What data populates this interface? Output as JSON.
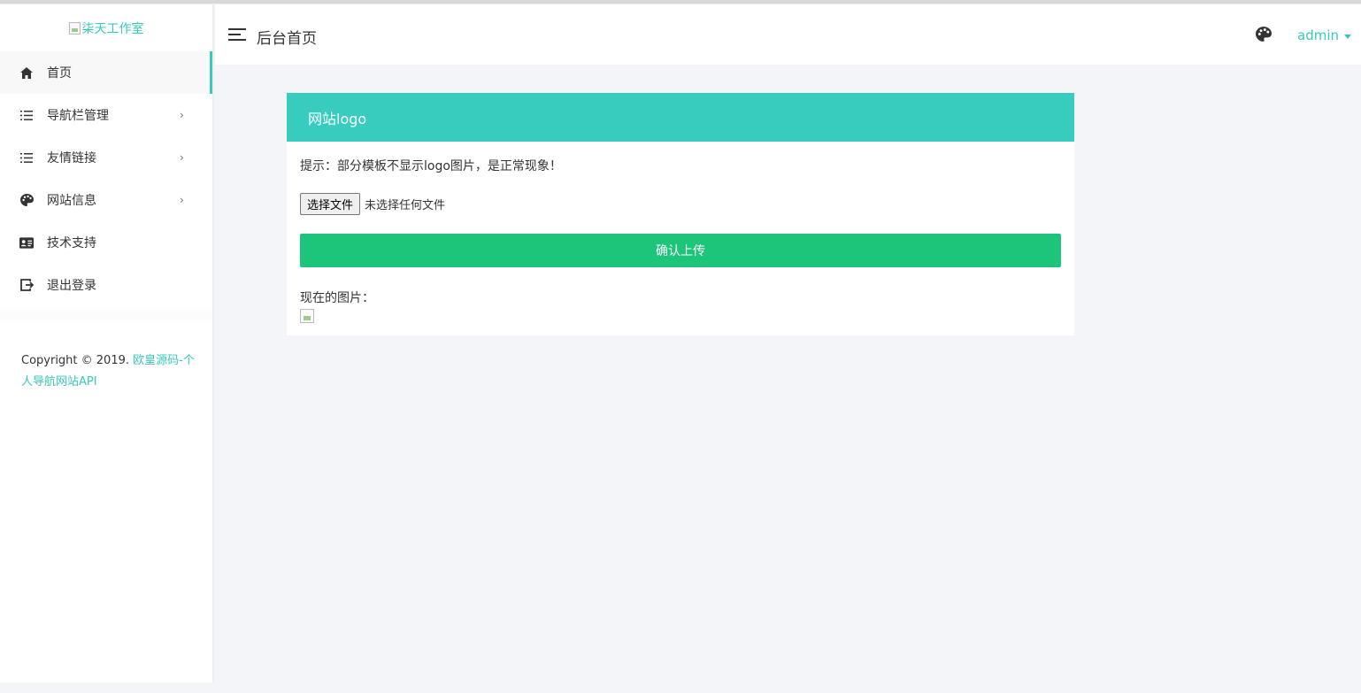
{
  "sidebar": {
    "logo_alt": "柒天工作室",
    "items": [
      {
        "label": "首页",
        "icon": "home-icon",
        "active": true,
        "has_arrow": false
      },
      {
        "label": "导航栏管理",
        "icon": "list-icon",
        "active": false,
        "has_arrow": true
      },
      {
        "label": "友情链接",
        "icon": "list-icon",
        "active": false,
        "has_arrow": true
      },
      {
        "label": "网站信息",
        "icon": "palette-icon",
        "active": false,
        "has_arrow": true
      },
      {
        "label": "技术支持",
        "icon": "id-card-icon",
        "active": false,
        "has_arrow": false
      },
      {
        "label": "退出登录",
        "icon": "logout-icon",
        "active": false,
        "has_arrow": false
      }
    ],
    "arrow": "›",
    "copyright_prefix": "Copyright © 2019.",
    "copyright_link": "欧皇源码-个人导航网站API"
  },
  "header": {
    "title": "后台首页",
    "user": "admin"
  },
  "panel": {
    "title": "网站logo",
    "hint": "提示：部分模板不显示logo图片，是正常现象！",
    "file_button": "选择文件",
    "file_status": "未选择任何文件",
    "upload_button": "确认上传",
    "current_label": "现在的图片："
  },
  "colors": {
    "accent": "#37c9ba",
    "panel_header": "#37ccbd",
    "upload_button": "#1cc57a",
    "background": "#f4f5f9"
  }
}
